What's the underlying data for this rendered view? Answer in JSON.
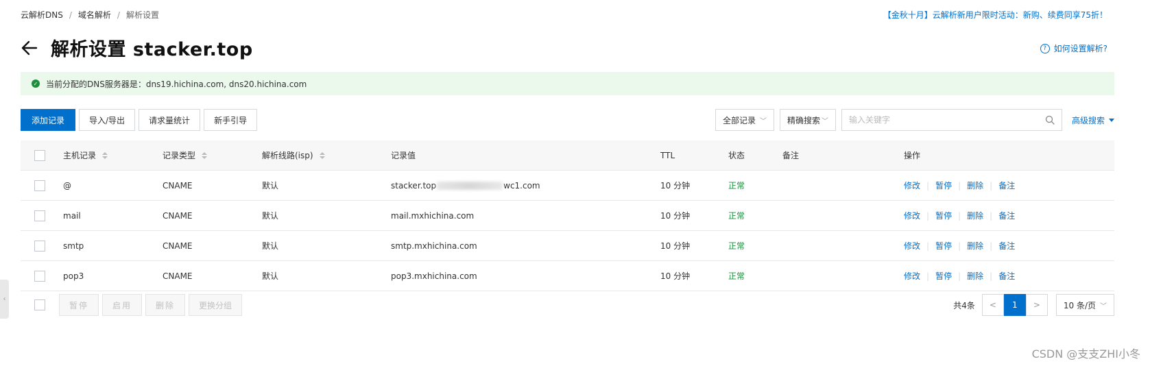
{
  "breadcrumb": [
    "云解析DNS",
    "域名解析",
    "解析设置"
  ],
  "breadcrumb_sep": "/",
  "promo": "【金秋十月】云解析新用户限时活动：新购、续费同享75折！",
  "page_title": "解析设置 stacker.top",
  "help_link": "如何设置解析?",
  "help_icon_glyph": "?",
  "notice": "当前分配的DNS服务器是：dns19.hichina.com, dns20.hichina.com",
  "toolbar": {
    "add": "添加记录",
    "import_export": "导入/导出",
    "stats": "请求量统计",
    "guide": "新手引导"
  },
  "filters": {
    "all_records": "全部记录",
    "exact_search": "精确搜索",
    "search_placeholder": "输入关键字",
    "advanced": "高级搜索"
  },
  "columns": {
    "host": "主机记录",
    "type": "记录类型",
    "line": "解析线路(isp)",
    "value": "记录值",
    "ttl": "TTL",
    "status": "状态",
    "remark": "备注",
    "ops": "操作"
  },
  "rows": [
    {
      "host": "@",
      "type": "CNAME",
      "line": "默认",
      "value_prefix": "stacker.top",
      "value_suffix": "wc1.com",
      "ttl": "10 分钟",
      "status": "正常"
    },
    {
      "host": "mail",
      "type": "CNAME",
      "line": "默认",
      "value_prefix": "mail.mxhichina.com",
      "value_suffix": "",
      "ttl": "10 分钟",
      "status": "正常"
    },
    {
      "host": "smtp",
      "type": "CNAME",
      "line": "默认",
      "value_prefix": "smtp.mxhichina.com",
      "value_suffix": "",
      "ttl": "10 分钟",
      "status": "正常"
    },
    {
      "host": "pop3",
      "type": "CNAME",
      "line": "默认",
      "value_prefix": "pop3.mxhichina.com",
      "value_suffix": "",
      "ttl": "10 分钟",
      "status": "正常"
    }
  ],
  "row_ops": [
    "修改",
    "暂停",
    "删除",
    "备注"
  ],
  "batch": [
    "暂停",
    "启用",
    "删除",
    "更换分组"
  ],
  "pager": {
    "total": "共4条",
    "prev": "<",
    "current": "1",
    "next": ">",
    "page_size": "10 条/页"
  },
  "watermark": "CSDN @支支ZHI小冬",
  "colors": {
    "accent": "#0070cc",
    "success": "#1e8e3e",
    "notice_bg": "#ebf8ec"
  }
}
